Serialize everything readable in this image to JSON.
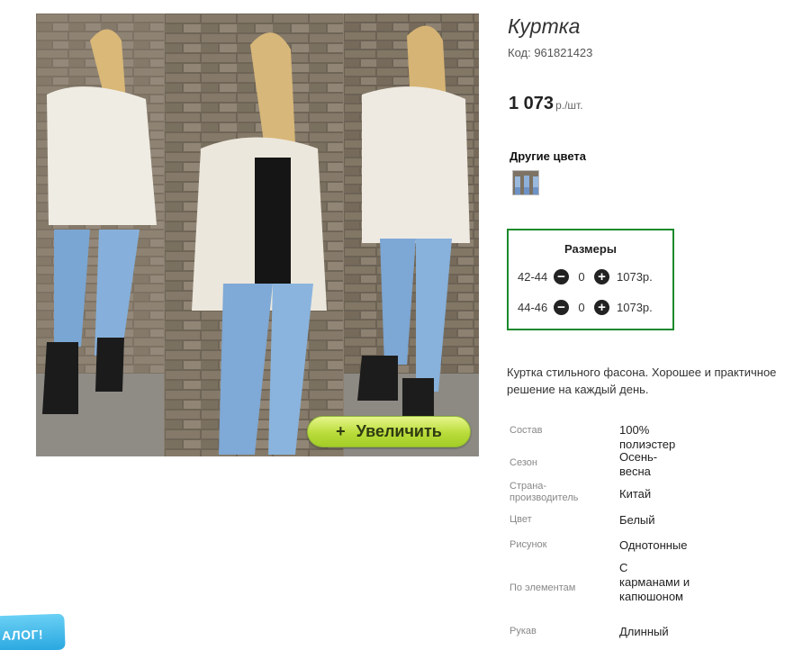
{
  "product": {
    "title": "Куртка",
    "code": "Код: 961821423",
    "price": "1 073",
    "price_unit": "р./шт."
  },
  "gallery": {
    "zoom_label": "Увеличить",
    "zoom_icon": "plus-icon"
  },
  "other_colors": {
    "title": "Другие цвета"
  },
  "sizes": {
    "title": "Размеры",
    "rows": [
      {
        "size": "42-44",
        "qty": "0",
        "price": "1073р."
      },
      {
        "size": "44-46",
        "qty": "0",
        "price": "1073р."
      }
    ]
  },
  "description": "Куртка стильного фасона. Хорошее и практичное решение на каждый день.",
  "properties": [
    {
      "key": "Состав",
      "value": "100% полиэстер"
    },
    {
      "key": "Сезон",
      "value": "Осень-весна"
    },
    {
      "key": "Страна-производитель",
      "value": "Китай"
    },
    {
      "key": "Цвет",
      "value": "Белый"
    },
    {
      "key": "Рисунок",
      "value": "Однотонные"
    },
    {
      "key": "По элементам",
      "value": "С карманами и капюшоном"
    },
    {
      "key": "Рукав",
      "value": "Длинный"
    }
  ],
  "catalog_badge": "АЛОГ!",
  "colors": {
    "size_box_border": "#1a8a2c",
    "zoom_button": "#b9dc3a",
    "catalog_badge": "#2aa8e0"
  }
}
